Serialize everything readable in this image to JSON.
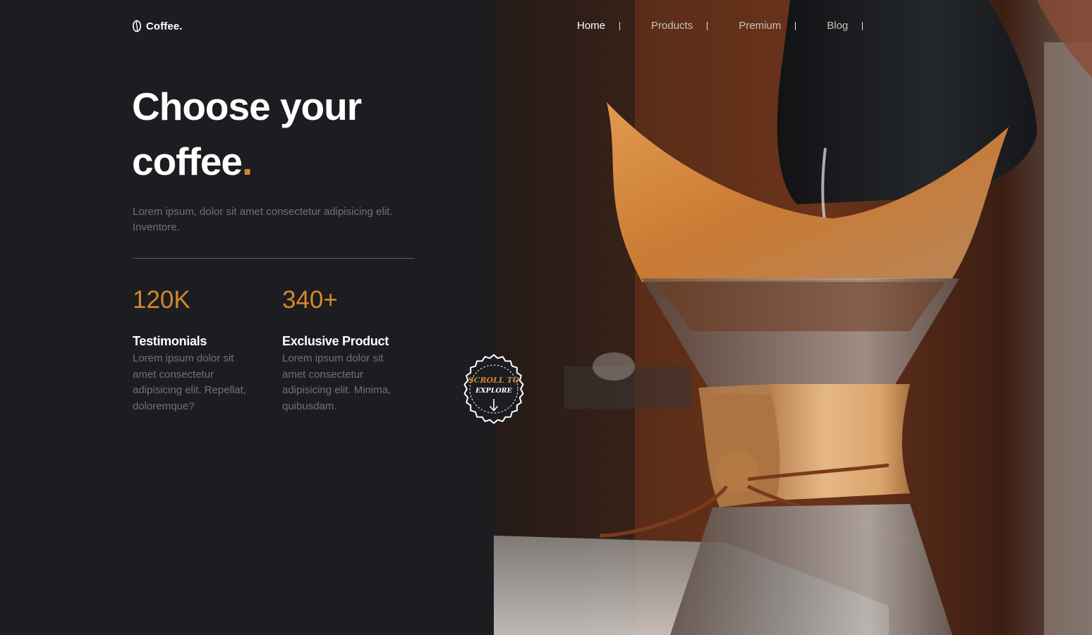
{
  "brand": {
    "name": "Coffee."
  },
  "nav": {
    "items": [
      {
        "label": "Home",
        "active": true
      },
      {
        "label": "Products",
        "active": false
      },
      {
        "label": "Premium",
        "active": false
      },
      {
        "label": "Blog",
        "active": false
      }
    ]
  },
  "hero": {
    "title_line1": "Choose your",
    "title_line2": "coffee",
    "title_accent": ".",
    "description": "Lorem ipsum, dolor sit amet consectetur adipisicing elit. Inventore."
  },
  "stats": [
    {
      "value": "120K",
      "label": "Testimonials",
      "description": "Lorem ipsum dolor sit amet consectetur adipisicing elit. Repellat, doloremque?"
    },
    {
      "value": "340+",
      "label": "Exclusive Product",
      "description": "Lorem ipsum dolor sit amet consectetur adipisicing elit. Minima, quibusdam."
    }
  ],
  "scroll_badge": {
    "line1": "SCROLL TO",
    "line2": "EXPLORE"
  },
  "colors": {
    "background": "#1b1d21",
    "accent": "#d4882a",
    "muted_text": "#6e7278"
  },
  "icons": {
    "logo": "coffee-bean-icon",
    "scroll": "arrow-down-icon"
  }
}
